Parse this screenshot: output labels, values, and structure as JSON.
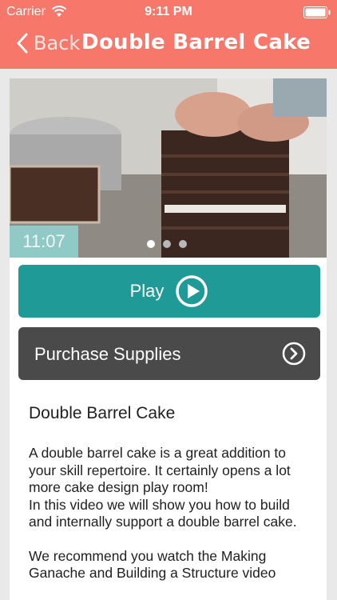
{
  "status_bar": {
    "carrier": "Carrier",
    "time": "9:11 PM"
  },
  "nav": {
    "back_label": "Back",
    "title": "Double Barrel Cake"
  },
  "video": {
    "duration": "11:07",
    "page_count": 3,
    "active_page": 0
  },
  "actions": {
    "play_label": "Play",
    "supplies_label": "Purchase Supplies"
  },
  "info": {
    "title": "Double Barrel Cake",
    "paragraph_1": "A double barrel cake is a great addition to your skill repertoire. It certainly opens a lot more cake design play room!",
    "paragraph_2": "In this video we will show you how to build and internally support a double barrel cake.",
    "paragraph_3": "We recommend you watch the Making Ganache and Building a Structure video"
  },
  "colors": {
    "header": "#f7786b",
    "play_button": "#1f9a96",
    "supplies_button": "#4a4a4a",
    "duration_badge": "#8fd0cc"
  }
}
